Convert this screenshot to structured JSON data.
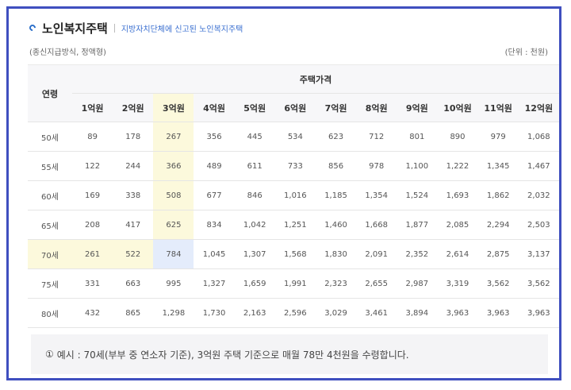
{
  "header": {
    "title": "노인복지주택",
    "subtitle": "지방자치단체에 신고된 노인복지주택"
  },
  "notes": {
    "left": "(종신지급방식, 정액형)",
    "right": "(단위 : 천원)"
  },
  "table": {
    "age_header": "연령",
    "group_header": "주택가격",
    "columns": [
      "1억원",
      "2억원",
      "3억원",
      "4억원",
      "5억원",
      "6억원",
      "7억원",
      "8억원",
      "9억원",
      "10억원",
      "11억원",
      "12억원"
    ],
    "rows": [
      {
        "age": "50세",
        "values": [
          "89",
          "178",
          "267",
          "356",
          "445",
          "534",
          "623",
          "712",
          "801",
          "890",
          "979",
          "1,068"
        ]
      },
      {
        "age": "55세",
        "values": [
          "122",
          "244",
          "366",
          "489",
          "611",
          "733",
          "856",
          "978",
          "1,100",
          "1,222",
          "1,345",
          "1,467"
        ]
      },
      {
        "age": "60세",
        "values": [
          "169",
          "338",
          "508",
          "677",
          "846",
          "1,016",
          "1,185",
          "1,354",
          "1,524",
          "1,693",
          "1,862",
          "2,032"
        ]
      },
      {
        "age": "65세",
        "values": [
          "208",
          "417",
          "625",
          "834",
          "1,042",
          "1,251",
          "1,460",
          "1,668",
          "1,877",
          "2,085",
          "2,294",
          "2,503"
        ]
      },
      {
        "age": "70세",
        "values": [
          "261",
          "522",
          "784",
          "1,045",
          "1,307",
          "1,568",
          "1,830",
          "2,091",
          "2,352",
          "2,614",
          "2,875",
          "3,137"
        ]
      },
      {
        "age": "75세",
        "values": [
          "331",
          "663",
          "995",
          "1,327",
          "1,659",
          "1,991",
          "2,323",
          "2,655",
          "2,987",
          "3,319",
          "3,562",
          "3,562"
        ]
      },
      {
        "age": "80세",
        "values": [
          "432",
          "865",
          "1,298",
          "1,730",
          "2,163",
          "2,596",
          "3,029",
          "3,461",
          "3,894",
          "3,963",
          "3,963",
          "3,963"
        ]
      }
    ]
  },
  "example": {
    "marker": "①",
    "text": "예시 : 70세(부부 중 연소자 기준), 3억원 주택 기준으로 매월 78만 4천원을 수령합니다."
  },
  "colors": {
    "frame": "#3f4fbf",
    "highlight_band": "#fcf9dc",
    "highlight_cell": "#e4ecfb",
    "accent": "#3a6fd0"
  }
}
